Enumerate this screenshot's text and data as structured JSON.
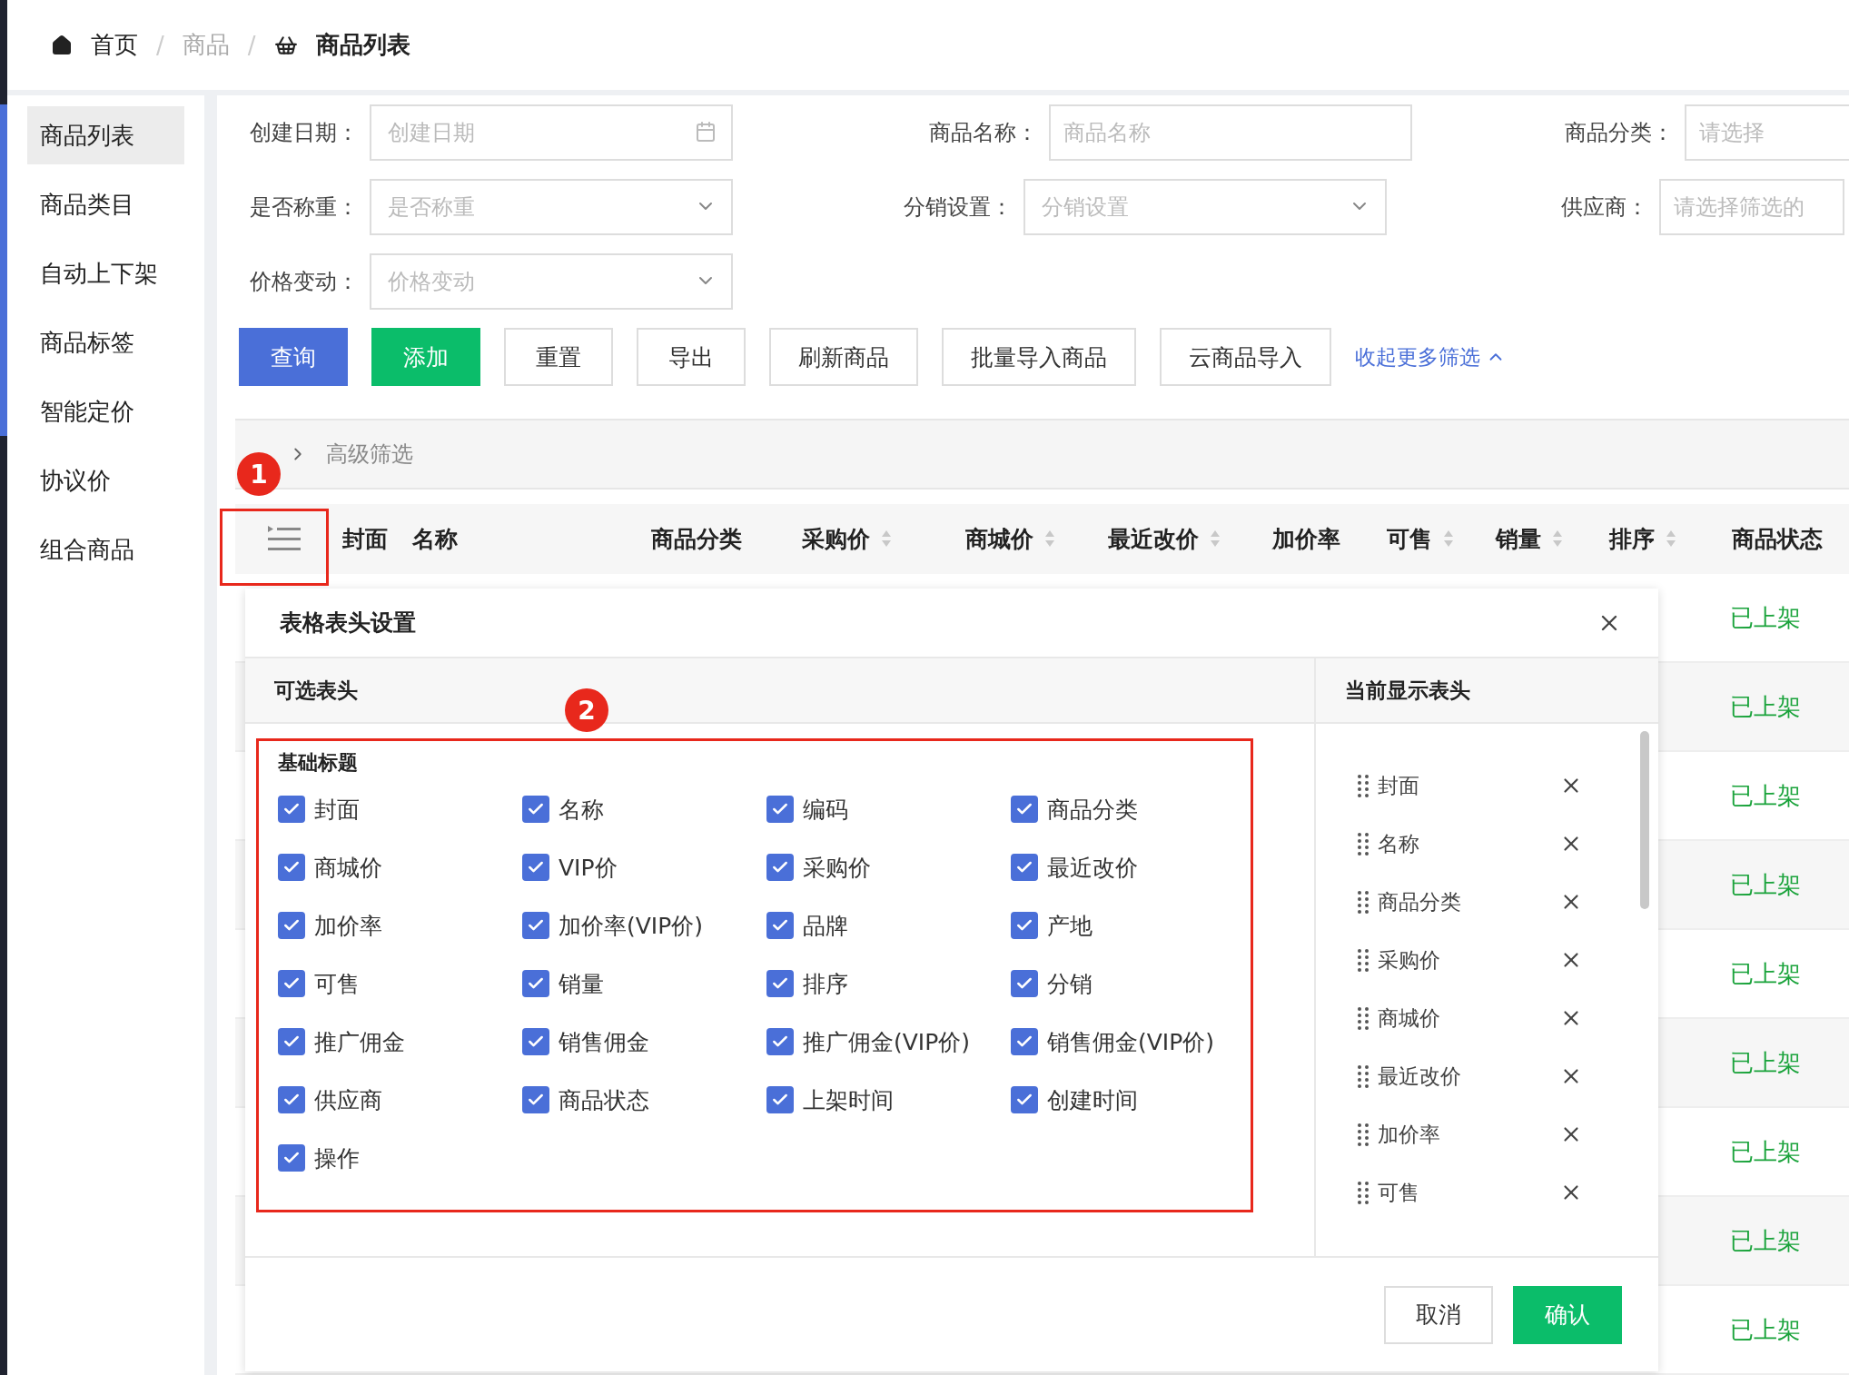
{
  "breadcrumb_separator": "/",
  "breadcrumb": [
    {
      "label": "首页",
      "kind": "home"
    },
    {
      "label": "商品",
      "kind": "plain"
    },
    {
      "label": "商品列表",
      "kind": "current"
    }
  ],
  "sidebar": {
    "items": [
      {
        "label": "商品列表",
        "selected": true
      },
      {
        "label": "商品类目",
        "selected": false
      },
      {
        "label": "自动上下架",
        "selected": false
      },
      {
        "label": "商品标签",
        "selected": false
      },
      {
        "label": "智能定价",
        "selected": false
      },
      {
        "label": "协议价",
        "selected": false
      },
      {
        "label": "组合商品",
        "selected": false
      }
    ]
  },
  "filters": [
    [
      {
        "label": "创建日期：",
        "placeholder": "创建日期",
        "kind": "date"
      },
      {
        "label": "商品名称：",
        "placeholder": "商品名称",
        "kind": "text"
      },
      {
        "label": "商品分类：",
        "placeholder": "请选择",
        "kind": "text"
      }
    ],
    [
      {
        "label": "是否称重：",
        "placeholder": "是否称重",
        "kind": "select"
      },
      {
        "label": "分销设置：",
        "placeholder": "分销设置",
        "kind": "select"
      },
      {
        "label": "供应商：",
        "placeholder": "请选择筛选的",
        "kind": "text"
      }
    ],
    [
      {
        "label": "价格变动：",
        "placeholder": "价格变动",
        "kind": "select"
      }
    ]
  ],
  "actions": [
    {
      "label": "查询",
      "kind": "primary"
    },
    {
      "label": "添加",
      "kind": "success"
    },
    {
      "label": "重置",
      "kind": "default"
    },
    {
      "label": "导出",
      "kind": "default"
    },
    {
      "label": "刷新商品",
      "kind": "default"
    },
    {
      "label": "批量导入商品",
      "kind": "default"
    },
    {
      "label": "云商品导入",
      "kind": "default"
    }
  ],
  "collapse_link": "收起更多筛选",
  "advanced_filter": "高级筛选",
  "table": {
    "columns": [
      {
        "label": "封面",
        "sortable": false
      },
      {
        "label": "名称",
        "sortable": false
      },
      {
        "label": "商品分类",
        "sortable": false
      },
      {
        "label": "采购价",
        "sortable": true
      },
      {
        "label": "商城价",
        "sortable": true
      },
      {
        "label": "最近改价",
        "sortable": true
      },
      {
        "label": "加价率",
        "sortable": false
      },
      {
        "label": "可售",
        "sortable": true
      },
      {
        "label": "销量",
        "sortable": true
      },
      {
        "label": "排序",
        "sortable": true
      },
      {
        "label": "商品状态",
        "sortable": false
      }
    ],
    "rows": [
      {
        "status": "已上架"
      },
      {
        "status": "已上架"
      },
      {
        "status": "已上架"
      },
      {
        "status": "已上架"
      },
      {
        "status": "已上架"
      },
      {
        "status": "已上架"
      },
      {
        "status": "已上架"
      },
      {
        "status": "已上架"
      },
      {
        "status": "已上架"
      }
    ]
  },
  "dialog": {
    "title": "表格表头设置",
    "left_header": "可选表头",
    "right_header": "当前显示表头",
    "group": "基础标题",
    "options": [
      {
        "label": "封面",
        "checked": true
      },
      {
        "label": "名称",
        "checked": true
      },
      {
        "label": "编码",
        "checked": true
      },
      {
        "label": "商品分类",
        "checked": true
      },
      {
        "label": "商城价",
        "checked": true
      },
      {
        "label": "VIP价",
        "checked": true
      },
      {
        "label": "采购价",
        "checked": true
      },
      {
        "label": "最近改价",
        "checked": true
      },
      {
        "label": "加价率",
        "checked": true
      },
      {
        "label": "加价率(VIP价)",
        "checked": true
      },
      {
        "label": "品牌",
        "checked": true
      },
      {
        "label": "产地",
        "checked": true
      },
      {
        "label": "可售",
        "checked": true
      },
      {
        "label": "销量",
        "checked": true
      },
      {
        "label": "排序",
        "checked": true
      },
      {
        "label": "分销",
        "checked": true
      },
      {
        "label": "推广佣金",
        "checked": true
      },
      {
        "label": "销售佣金",
        "checked": true
      },
      {
        "label": "推广佣金(VIP价)",
        "checked": true
      },
      {
        "label": "销售佣金(VIP价)",
        "checked": true
      },
      {
        "label": "供应商",
        "checked": true
      },
      {
        "label": "商品状态",
        "checked": true
      },
      {
        "label": "上架时间",
        "checked": true
      },
      {
        "label": "创建时间",
        "checked": true
      },
      {
        "label": "操作",
        "checked": true
      }
    ],
    "current": [
      "封面",
      "名称",
      "商品分类",
      "采购价",
      "商城价",
      "最近改价",
      "加价率",
      "可售"
    ],
    "buttons": [
      {
        "label": "取消",
        "kind": "default"
      },
      {
        "label": "确认",
        "kind": "success"
      }
    ]
  },
  "annotations": [
    {
      "label": "1"
    },
    {
      "label": "2"
    }
  ]
}
